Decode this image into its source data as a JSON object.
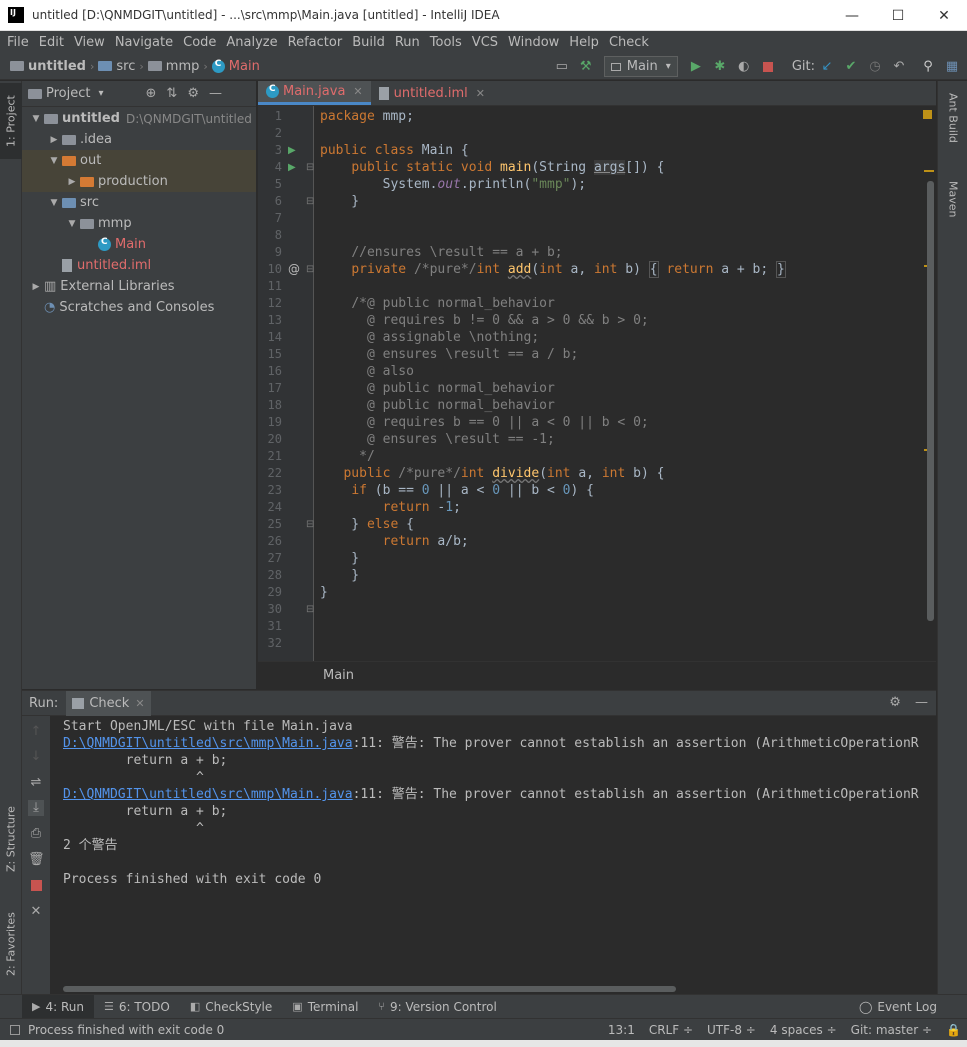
{
  "window": {
    "title": "untitled [D:\\QNMDGIT\\untitled] - ...\\src\\mmp\\Main.java [untitled] - IntelliJ IDEA",
    "minimize": "—",
    "maximize": "☐",
    "close": "✕"
  },
  "menu": [
    "File",
    "Edit",
    "View",
    "Navigate",
    "Code",
    "Analyze",
    "Refactor",
    "Build",
    "Run",
    "Tools",
    "VCS",
    "Window",
    "Help",
    "Check"
  ],
  "nav": {
    "project": "untitled",
    "src": "src",
    "pkg": "mmp",
    "cls": "Main",
    "sep": "›"
  },
  "toolbar": {
    "run_config": "Main",
    "run_config_arrow": "▾",
    "git_label": "Git:",
    "colors": {
      "run": "#59a869",
      "debug": "#59a869",
      "stop": "#c75450",
      "git_update": "#3592c4",
      "git_commit": "#59a869"
    }
  },
  "left_tabs": {
    "project": "1: Project",
    "structure": "Z: Structure",
    "favorites": "2: Favorites"
  },
  "right_tabs": {
    "ant": "Ant Build",
    "maven": "Maven"
  },
  "project_panel": {
    "header": "Project",
    "header_arrow": "▾",
    "tree": [
      {
        "label": "untitled",
        "path": "D:\\QNMDGIT\\untitled",
        "indent": 0,
        "arrow": "▼",
        "icon": "folder-grey",
        "bold": true
      },
      {
        "label": ".idea",
        "indent": 1,
        "arrow": "▶",
        "icon": "folder-grey"
      },
      {
        "label": "out",
        "indent": 1,
        "arrow": "▼",
        "icon": "folder-orange",
        "highlighted": true
      },
      {
        "label": "production",
        "indent": 2,
        "arrow": "▶",
        "icon": "folder-orange",
        "highlighted": true
      },
      {
        "label": "src",
        "indent": 1,
        "arrow": "▼",
        "icon": "folder-blue"
      },
      {
        "label": "mmp",
        "indent": 2,
        "arrow": "▼",
        "icon": "folder-grey"
      },
      {
        "label": "Main",
        "indent": 3,
        "arrow": "",
        "icon": "class",
        "red": true
      },
      {
        "label": "untitled.iml",
        "indent": 1,
        "arrow": "",
        "icon": "file",
        "red": true
      },
      {
        "label": "External Libraries",
        "indent": 0,
        "arrow": "▶",
        "icon": "libs"
      },
      {
        "label": "Scratches and Consoles",
        "indent": 0,
        "arrow": "",
        "icon": "scratch"
      }
    ]
  },
  "editor": {
    "tabs": [
      {
        "label": "Main.java",
        "active": true,
        "close": "✕"
      },
      {
        "label": "untitled.iml",
        "active": false,
        "close": "✕"
      }
    ],
    "breadcrumb": "Main",
    "line_numbers": [
      "1",
      "2",
      "3",
      "4",
      "5",
      "6",
      "7",
      "8",
      "9",
      "10",
      "11",
      "12",
      "13",
      "14",
      "15",
      "16",
      "17",
      "18",
      "19",
      "20",
      "21",
      "22",
      "23",
      "24",
      "25",
      "26",
      "27",
      "28",
      "29",
      "30",
      "31",
      "32"
    ],
    "gutter_at": "@"
  },
  "run_panel": {
    "label": "Run:",
    "tab": "Check",
    "tab_close": "✕",
    "console": {
      "l1": "Start OpenJML/ESC with file Main.java",
      "l2_link": "D:\\QNMDGIT\\untitled\\src\\mmp\\Main.java",
      "l2_rest": ":11: 警告: The prover cannot establish an assertion (ArithmeticOperationR",
      "l3": "        return a + b;",
      "l4": "                 ^",
      "l6_link": "D:\\QNMDGIT\\untitled\\src\\mmp\\Main.java",
      "l6_rest": ":11: 警告: The prover cannot establish an assertion (ArithmeticOperationR",
      "l7": "        return a + b;",
      "l8": "                 ^",
      "l9": "2 个警告",
      "l10": "Process finished with exit code 0"
    }
  },
  "bottom_tabs": [
    {
      "label": "4: Run",
      "active": true,
      "icon": "▶"
    },
    {
      "label": "6: TODO",
      "icon": "☰"
    },
    {
      "label": "CheckStyle",
      "icon": "◧"
    },
    {
      "label": "Terminal",
      "icon": "▣"
    },
    {
      "label": "9: Version Control",
      "icon": "⑂"
    }
  ],
  "event_log": "Event Log",
  "status": {
    "message": "Process finished with exit code 0",
    "position": "13:1",
    "line_sep": "CRLF ÷",
    "encoding": "UTF-8 ÷",
    "indent": "4 spaces ÷",
    "git": "Git: master ÷"
  }
}
